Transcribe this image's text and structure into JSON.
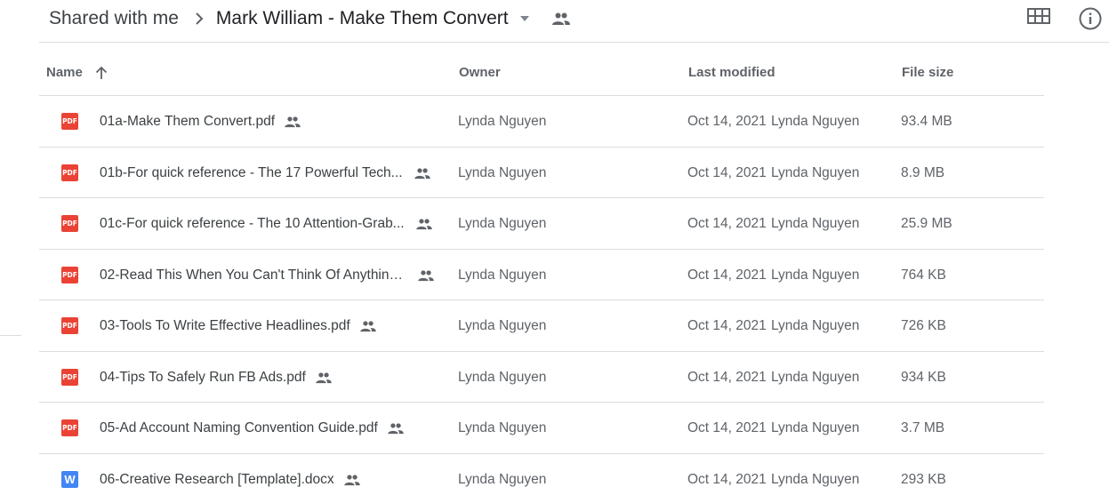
{
  "breadcrumb": {
    "root": "Shared with me",
    "current": "Mark William - Make Them Convert"
  },
  "icons": {
    "separator": "chevron-right-icon",
    "caret": "arrow-drop-down-icon",
    "shared": "people-icon",
    "grid_view": "grid-view-icon",
    "info": "info-icon",
    "sort": "arrow-up-icon"
  },
  "colors": {
    "pdf": "#ea4335",
    "docx": "#4285f4",
    "divider": "#dadce0",
    "text_primary": "#3c4043",
    "text_secondary": "#5f6368"
  },
  "columns": {
    "name": "Name",
    "owner": "Owner",
    "last_modified": "Last modified",
    "file_size": "File size"
  },
  "files": [
    {
      "name": "01a-Make Them Convert.pdf",
      "type": "pdf",
      "type_label": "PDF",
      "owner": "Lynda Nguyen",
      "modified_date": "Oct 14, 2021",
      "modified_by": "Lynda Nguyen",
      "size": "93.4 MB",
      "truncated": false
    },
    {
      "name": "01b-For quick reference - The 17 Powerful Tech...",
      "type": "pdf",
      "type_label": "PDF",
      "owner": "Lynda Nguyen",
      "modified_date": "Oct 14, 2021",
      "modified_by": "Lynda Nguyen",
      "size": "8.9 MB",
      "truncated": true
    },
    {
      "name": "01c-For quick reference - The 10 Attention-Grab...",
      "type": "pdf",
      "type_label": "PDF",
      "owner": "Lynda Nguyen",
      "modified_date": "Oct 14, 2021",
      "modified_by": "Lynda Nguyen",
      "size": "25.9 MB",
      "truncated": true
    },
    {
      "name": "02-Read This When You Can't Think Of Anything ...",
      "type": "pdf",
      "type_label": "PDF",
      "owner": "Lynda Nguyen",
      "modified_date": "Oct 14, 2021",
      "modified_by": "Lynda Nguyen",
      "size": "764 KB",
      "truncated": true
    },
    {
      "name": "03-Tools To Write Effective Headlines.pdf",
      "type": "pdf",
      "type_label": "PDF",
      "owner": "Lynda Nguyen",
      "modified_date": "Oct 14, 2021",
      "modified_by": "Lynda Nguyen",
      "size": "726 KB",
      "truncated": false
    },
    {
      "name": "04-Tips To Safely Run FB Ads.pdf",
      "type": "pdf",
      "type_label": "PDF",
      "owner": "Lynda Nguyen",
      "modified_date": "Oct 14, 2021",
      "modified_by": "Lynda Nguyen",
      "size": "934 KB",
      "truncated": false
    },
    {
      "name": "05-Ad Account Naming Convention Guide.pdf",
      "type": "pdf",
      "type_label": "PDF",
      "owner": "Lynda Nguyen",
      "modified_date": "Oct 14, 2021",
      "modified_by": "Lynda Nguyen",
      "size": "3.7 MB",
      "truncated": false
    },
    {
      "name": "06-Creative Research [Template].docx",
      "type": "docx",
      "type_label": "W",
      "owner": "Lynda Nguyen",
      "modified_date": "Oct 14, 2021",
      "modified_by": "Lynda Nguyen",
      "size": "293 KB",
      "truncated": false
    }
  ]
}
